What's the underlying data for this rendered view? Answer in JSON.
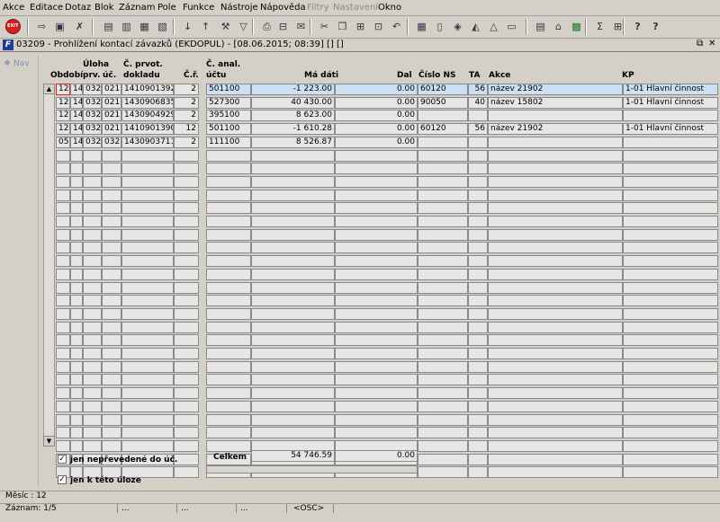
{
  "menu": {
    "items": [
      {
        "label": "Akce",
        "disabled": false
      },
      {
        "label": "Editace",
        "disabled": false
      },
      {
        "label": "Dotaz",
        "disabled": false
      },
      {
        "label": "Blok",
        "disabled": false
      },
      {
        "label": "Záznam",
        "disabled": false
      },
      {
        "label": "Pole",
        "disabled": false
      },
      {
        "label": "Funkce",
        "disabled": false
      },
      {
        "label": "Nástroje",
        "disabled": false
      },
      {
        "label": "Nápověda",
        "disabled": false
      },
      {
        "label": "Filtry",
        "disabled": true
      },
      {
        "label": "Nastavení",
        "disabled": true
      },
      {
        "label": "Okno",
        "disabled": false
      }
    ]
  },
  "toolbar": {
    "exit_label": "EXIT",
    "icons": [
      "enter-query-icon",
      "execute-query-icon",
      "cancel-query-icon",
      "save-icon",
      "insert-record-icon",
      "delete-record-icon",
      "clear-icon",
      "sort-asc-icon",
      "sort-desc-icon",
      "tools-icon",
      "filter-icon",
      "print-icon",
      "print-preview-icon",
      "mail-icon",
      "cut-icon",
      "copy-icon",
      "paste-icon",
      "paste-special-icon",
      "undo-icon",
      "calculator-icon",
      "document-icon",
      "plugin-icon",
      "chart-icon",
      "triangle-icon",
      "terminal-icon",
      "calendar-icon",
      "bank-icon",
      "excel-icon",
      "sum-icon",
      "table-icon",
      "help-context-icon",
      "help-icon"
    ]
  },
  "window": {
    "title": "03209 - Prohlížení kontací závazků (EKDOPUL) - [08.06.2015; 08:39] [] []",
    "app_icon": "F"
  },
  "nav": {
    "label": "Nav"
  },
  "table": {
    "headers": {
      "obdobi": "Období",
      "uloha_1": "Úloha",
      "uloha_2": "prv.",
      "uc": "úč.",
      "prvot_1": "Č. prvot.",
      "prvot_2": "dokladu",
      "cr": "Č.ř.",
      "anal_1": "Č. anal.",
      "anal_2": "účtu",
      "ma_dati": "Má dáti",
      "dal": "Dal",
      "cislo_ns": "Číslo NS",
      "ta": "TA",
      "akce": "Akce",
      "kp": "KP"
    },
    "rows": [
      {
        "obdobi": "12",
        "uloha": "14",
        "prv": "032",
        "uc": "021",
        "doklad": "1410901392",
        "cr": "2",
        "ucet": "501100",
        "ma_dati": "-1 223.00",
        "dal": "0.00",
        "ns": "60120",
        "ta": "56",
        "akce": "název 21902",
        "kp": "1-01 Hlavní činnost"
      },
      {
        "obdobi": "12",
        "uloha": "14",
        "prv": "032",
        "uc": "021",
        "doklad": "1430906835",
        "cr": "2",
        "ucet": "527300",
        "ma_dati": "40 430.00",
        "dal": "0.00",
        "ns": "90050",
        "ta": "40",
        "akce": "název 15802",
        "kp": "1-01 Hlavní činnost"
      },
      {
        "obdobi": "12",
        "uloha": "14",
        "prv": "032",
        "uc": "021",
        "doklad": "1430904929",
        "cr": "2",
        "ucet": "395100",
        "ma_dati": "8 623.00",
        "dal": "0.00",
        "ns": "",
        "ta": "",
        "akce": "",
        "kp": ""
      },
      {
        "obdobi": "12",
        "uloha": "14",
        "prv": "032",
        "uc": "021",
        "doklad": "1410901390",
        "cr": "12",
        "ucet": "501100",
        "ma_dati": "-1 610.28",
        "dal": "0.00",
        "ns": "60120",
        "ta": "56",
        "akce": "název 21902",
        "kp": "1-01 Hlavní činnost"
      },
      {
        "obdobi": "05",
        "uloha": "14",
        "prv": "032",
        "uc": "032",
        "doklad": "1430903711",
        "cr": "2",
        "ucet": "111100",
        "ma_dati": "8 526.87",
        "dal": "0.00",
        "ns": "",
        "ta": "",
        "akce": "",
        "kp": ""
      }
    ],
    "empty_rows": 25
  },
  "totals": {
    "label": "Celkem",
    "ma_dati": "54 746.59",
    "dal": "0.00"
  },
  "filters": [
    {
      "label": "jen nepřevedené do úč.",
      "checked": true
    },
    {
      "label": "jen k této úloze",
      "checked": true
    }
  ],
  "status": {
    "line1": "Měsíc : 12",
    "record": "Záznam: 1/5",
    "dots": "...",
    "osc": "<OSC>"
  }
}
